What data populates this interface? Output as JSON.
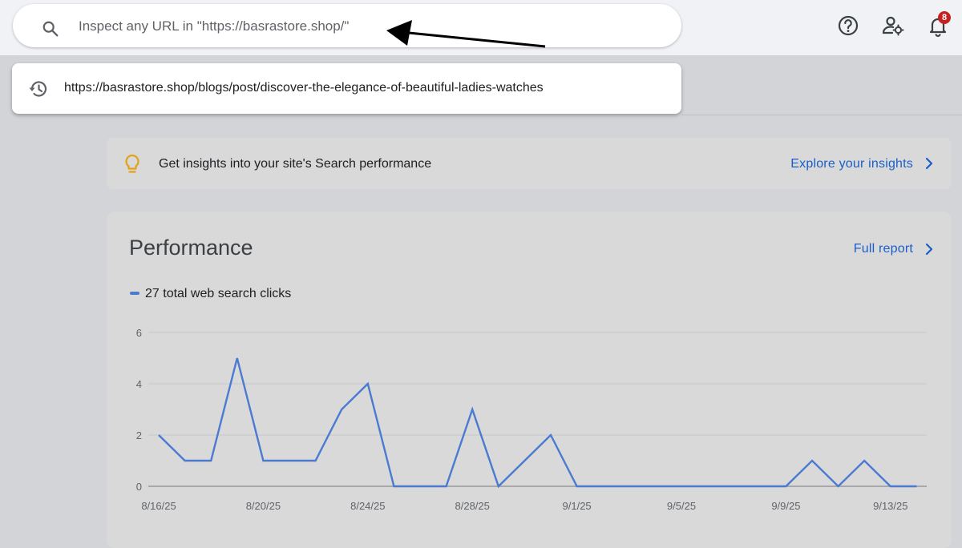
{
  "search": {
    "placeholder": "Inspect any URL in \"https://basrastore.shop/\""
  },
  "header_icons": {
    "help": "help-icon",
    "settings": "user-settings-icon",
    "notifications": "bell-icon",
    "notification_count": "8"
  },
  "suggestion": {
    "url": "https://basrastore.shop/blogs/post/discover-the-elegance-of-beautiful-ladies-watches"
  },
  "insights": {
    "text": "Get insights into your site's Search performance",
    "link": "Explore your insights"
  },
  "performance": {
    "title": "Performance",
    "full_report": "Full report",
    "legend": "27 total web search clicks"
  },
  "colors": {
    "line": "#4a7bd0",
    "link": "#1a5fc7",
    "badge": "#c5221f"
  },
  "chart_data": {
    "type": "line",
    "x": [
      "8/16/25",
      "8/17/25",
      "8/18/25",
      "8/19/25",
      "8/20/25",
      "8/21/25",
      "8/22/25",
      "8/23/25",
      "8/24/25",
      "8/25/25",
      "8/26/25",
      "8/27/25",
      "8/28/25",
      "8/29/25",
      "8/30/25",
      "8/31/25",
      "9/1/25",
      "9/2/25",
      "9/3/25",
      "9/4/25",
      "9/5/25",
      "9/6/25",
      "9/7/25",
      "9/8/25",
      "9/9/25",
      "9/10/25",
      "9/11/25",
      "9/12/25",
      "9/13/25",
      "9/14/25"
    ],
    "series": [
      {
        "name": "27 total web search clicks",
        "values": [
          2,
          1,
          1,
          5,
          1,
          1,
          1,
          3,
          4,
          0,
          0,
          0,
          3,
          0,
          1,
          2,
          0,
          0,
          0,
          0,
          0,
          0,
          0,
          0,
          0,
          1,
          0,
          1,
          0,
          0
        ]
      }
    ],
    "x_tick_labels": [
      "8/16/25",
      "8/20/25",
      "8/24/25",
      "8/28/25",
      "9/1/25",
      "9/5/25",
      "9/9/25",
      "9/13/25"
    ],
    "y_ticks": [
      "0",
      "2",
      "4",
      "6"
    ],
    "ylim": [
      0,
      6
    ],
    "grid": true
  }
}
